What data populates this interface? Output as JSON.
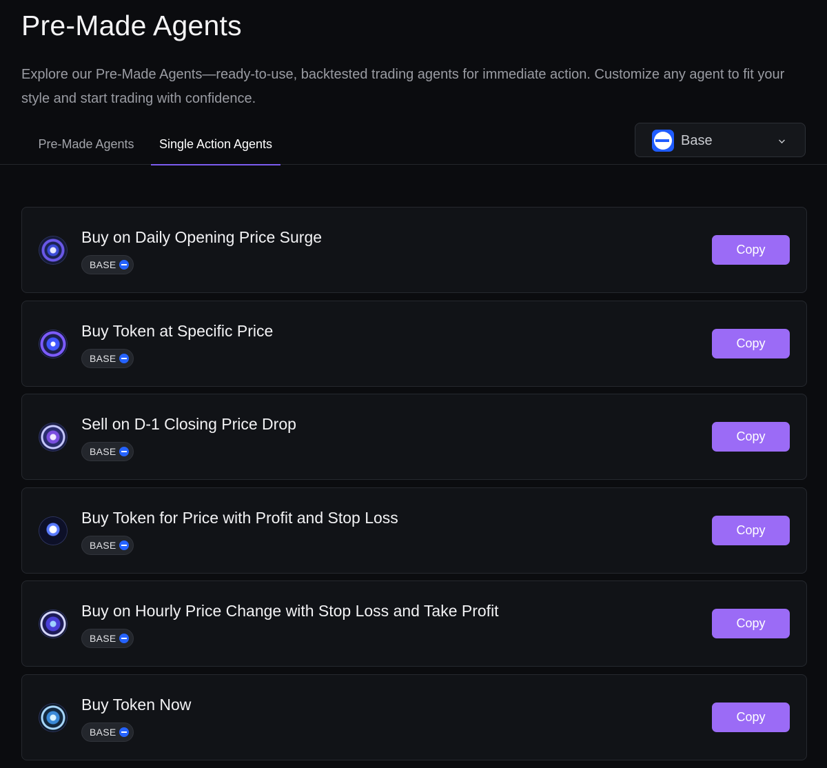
{
  "header": {
    "title": "Pre-Made Agents",
    "description": "Explore our Pre-Made Agents—ready-to-use, backtested trading agents for immediate action. Customize any agent to fit your style and start trading with confidence."
  },
  "tabs": [
    {
      "label": "Pre-Made Agents",
      "active": false
    },
    {
      "label": "Single Action Agents",
      "active": true
    }
  ],
  "network_select": {
    "selected": "Base",
    "icon": "base-network-icon"
  },
  "colors": {
    "accent": "#9b6bf6",
    "tab_underline": "#7c5cf0",
    "base_blue": "#2563ff",
    "background": "#0b0c0f",
    "card": "#111317"
  },
  "agents": [
    {
      "title": "Buy on Daily Opening Price Surge",
      "badge": "BASE",
      "button": "Copy"
    },
    {
      "title": "Buy Token at Specific Price",
      "badge": "BASE",
      "button": "Copy"
    },
    {
      "title": "Sell on D-1 Closing Price Drop",
      "badge": "BASE",
      "button": "Copy"
    },
    {
      "title": "Buy Token for Price with Profit and Stop Loss",
      "badge": "BASE",
      "button": "Copy"
    },
    {
      "title": "Buy on Hourly Price Change with Stop Loss and Take Profit",
      "badge": "BASE",
      "button": "Copy"
    },
    {
      "title": "Buy Token Now",
      "badge": "BASE",
      "button": "Copy"
    }
  ]
}
